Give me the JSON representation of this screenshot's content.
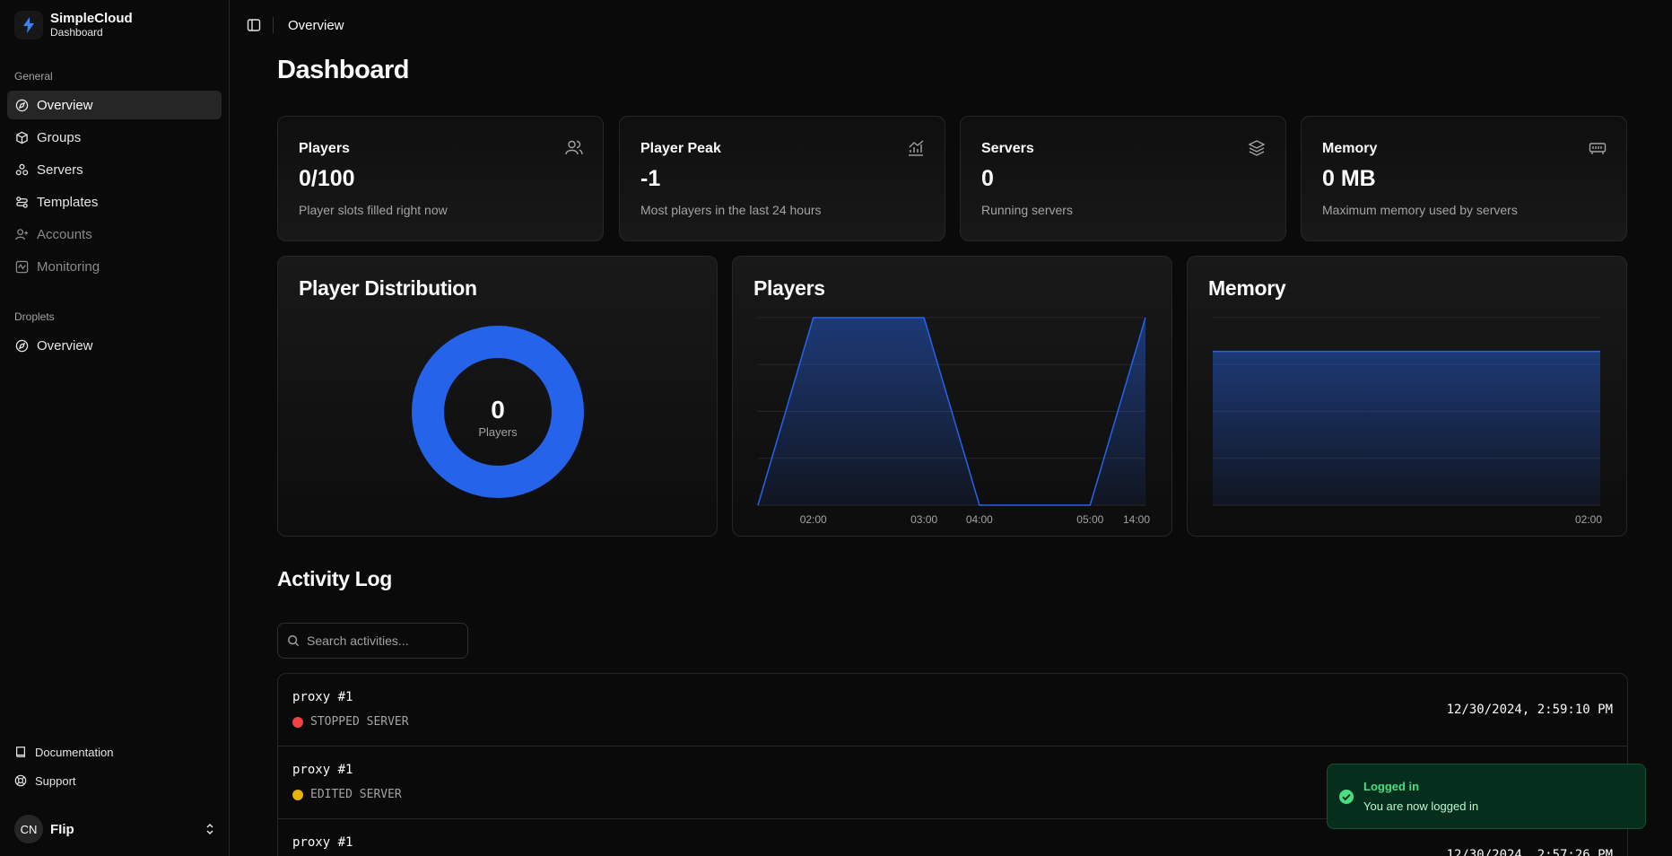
{
  "brand": {
    "name": "SimpleCloud",
    "subtitle": "Dashboard"
  },
  "sidebar": {
    "general_label": "General",
    "items": [
      {
        "label": "Overview",
        "icon": "compass-icon",
        "active": true
      },
      {
        "label": "Groups",
        "icon": "box-icon"
      },
      {
        "label": "Servers",
        "icon": "cluster-icon"
      },
      {
        "label": "Templates",
        "icon": "template-icon"
      },
      {
        "label": "Accounts",
        "icon": "user-icon",
        "muted": true
      },
      {
        "label": "Monitoring",
        "icon": "monitoring-icon",
        "muted": true
      }
    ],
    "droplets_label": "Droplets",
    "droplet_items": [
      {
        "label": "Overview",
        "icon": "compass-icon"
      }
    ],
    "footer": [
      {
        "label": "Documentation",
        "icon": "book-icon"
      },
      {
        "label": "Support",
        "icon": "lifebuoy-icon"
      }
    ],
    "user": {
      "initials": "CN",
      "name": "FIip"
    }
  },
  "topbar": {
    "breadcrumb": "Overview"
  },
  "page_title": "Dashboard",
  "stats": [
    {
      "label": "Players",
      "value": "0/100",
      "description": "Player slots filled right now",
      "icon": "users-icon"
    },
    {
      "label": "Player Peak",
      "value": "-1",
      "description": "Most players in the last 24 hours",
      "icon": "chart-line-icon"
    },
    {
      "label": "Servers",
      "value": "0",
      "description": "Running servers",
      "icon": "layers-icon"
    },
    {
      "label": "Memory",
      "value": "0 MB",
      "description": "Maximum memory used by servers",
      "icon": "memory-icon"
    }
  ],
  "charts": {
    "distribution": {
      "title": "Player Distribution",
      "center_value": "0",
      "center_label": "Players",
      "color": "#2563eb"
    },
    "players": {
      "title": "Players",
      "color": "#2563eb"
    },
    "memory": {
      "title": "Memory",
      "color": "#2563eb"
    }
  },
  "chart_data": [
    {
      "type": "pie",
      "title": "Player Distribution",
      "values": [
        1
      ],
      "labels": [
        ""
      ]
    },
    {
      "type": "area",
      "title": "Players",
      "x": [
        "",
        "02:00",
        "",
        "03:00",
        "04:00",
        "",
        "05:00",
        "14:00"
      ],
      "x_ticks": [
        "02:00",
        "03:00",
        "04:00",
        "05:00",
        "14:00"
      ],
      "values": [
        0,
        1,
        1,
        1,
        0,
        0,
        0,
        1
      ]
    },
    {
      "type": "area",
      "title": "Memory",
      "x": [
        "02:00"
      ],
      "x_ticks": [
        "02:00"
      ],
      "values": [
        1
      ]
    }
  ],
  "activity": {
    "title": "Activity Log",
    "search_placeholder": "Search activities...",
    "rows": [
      {
        "name": "proxy #1",
        "status": "STOPPED SERVER",
        "status_color": "#ef4444",
        "time": "12/30/2024, 2:59:10 PM"
      },
      {
        "name": "proxy #1",
        "status": "EDITED SERVER",
        "status_color": "#eab308",
        "time": ""
      },
      {
        "name": "proxy #1",
        "status": "",
        "status_color": "",
        "time": "12/30/2024, 2:57:26 PM"
      }
    ]
  },
  "toast": {
    "title": "Logged in",
    "message": "You are now logged in",
    "accent": "#4ade80"
  }
}
